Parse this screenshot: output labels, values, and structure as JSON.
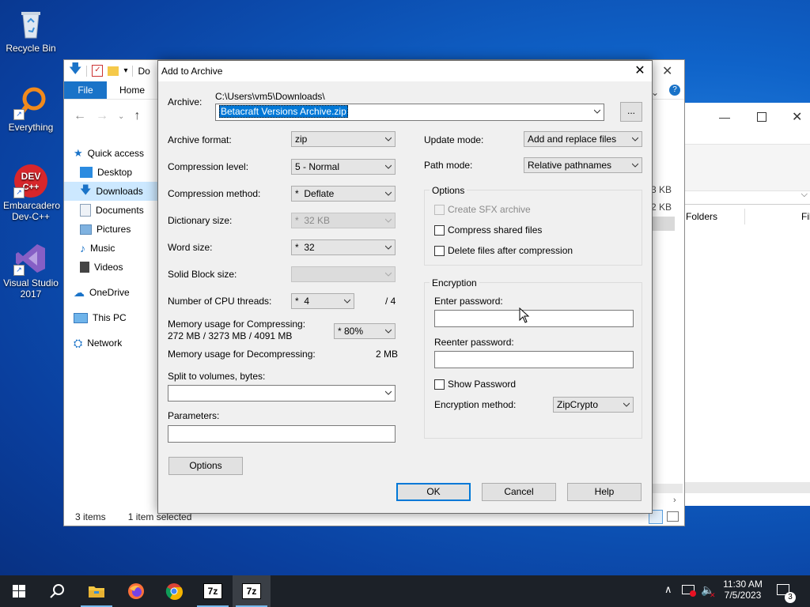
{
  "desktop": {
    "icons": [
      {
        "label": "Recycle Bin"
      },
      {
        "label": "Everything"
      },
      {
        "label": "Embarcadero Dev-C++"
      },
      {
        "label": "Visual Studio 2017"
      }
    ]
  },
  "explorer": {
    "title_fragment": "Do",
    "ribbon": {
      "file": "File",
      "home": "Home"
    },
    "sidebar": [
      {
        "label": "Quick access"
      },
      {
        "label": "Desktop"
      },
      {
        "label": "Downloads"
      },
      {
        "label": "Documents"
      },
      {
        "label": "Pictures"
      },
      {
        "label": "Music"
      },
      {
        "label": "Videos"
      },
      {
        "label": "OneDrive"
      },
      {
        "label": "This PC"
      },
      {
        "label": "Network"
      }
    ],
    "status": {
      "items": "3 items",
      "selected": "1 item selected"
    },
    "sizes": [
      "3 KB",
      "2 KB"
    ],
    "col_folders": "Folders",
    "col_fi": "Fil"
  },
  "dialog": {
    "title": "Add to Archive",
    "archive_label": "Archive:",
    "archive_path": "C:\\Users\\vm5\\Downloads\\",
    "archive_name": "Betacraft Versions Archive.zip",
    "browse": "...",
    "archive_format": {
      "label": "Archive format:",
      "value": "zip"
    },
    "compression_level": {
      "label": "Compression level:",
      "value": "5 - Normal"
    },
    "compression_method": {
      "label": "Compression method:",
      "value": "*  Deflate"
    },
    "dictionary_size": {
      "label": "Dictionary size:",
      "value": "*  32 KB"
    },
    "word_size": {
      "label": "Word size:",
      "value": "*  32"
    },
    "solid_block": {
      "label": "Solid Block size:",
      "value": ""
    },
    "cpu_threads": {
      "label": "Number of CPU threads:",
      "value": "*  4",
      "max": "/ 4"
    },
    "mem_compress": {
      "label": "Memory usage for Compressing:",
      "detail": "272 MB / 3273 MB / 4091 MB",
      "value": "* 80%"
    },
    "mem_decompress": {
      "label": "Memory usage for Decompressing:",
      "value": "2 MB"
    },
    "split": {
      "label": "Split to volumes, bytes:",
      "value": ""
    },
    "parameters": {
      "label": "Parameters:",
      "value": ""
    },
    "options_button": "Options",
    "update_mode": {
      "label": "Update mode:",
      "value": "Add and replace files"
    },
    "path_mode": {
      "label": "Path mode:",
      "value": "Relative pathnames"
    },
    "options_group": {
      "title": "Options",
      "sfx": "Create SFX archive",
      "shared": "Compress shared files",
      "delete": "Delete files after compression"
    },
    "encryption": {
      "title": "Encryption",
      "enter": "Enter password:",
      "reenter": "Reenter password:",
      "show": "Show Password",
      "method_label": "Encryption method:",
      "method_value": "ZipCrypto"
    },
    "ok": "OK",
    "cancel": "Cancel",
    "help": "Help"
  },
  "taskbar": {
    "clock_time": "11:30 AM",
    "clock_date": "7/5/2023",
    "notif_count": "3",
    "sevenzip_label": "7z"
  },
  "colors": {
    "accent": "#0078d7",
    "taskbar": "#1c2128",
    "ribbon_file": "#1a73c8"
  }
}
